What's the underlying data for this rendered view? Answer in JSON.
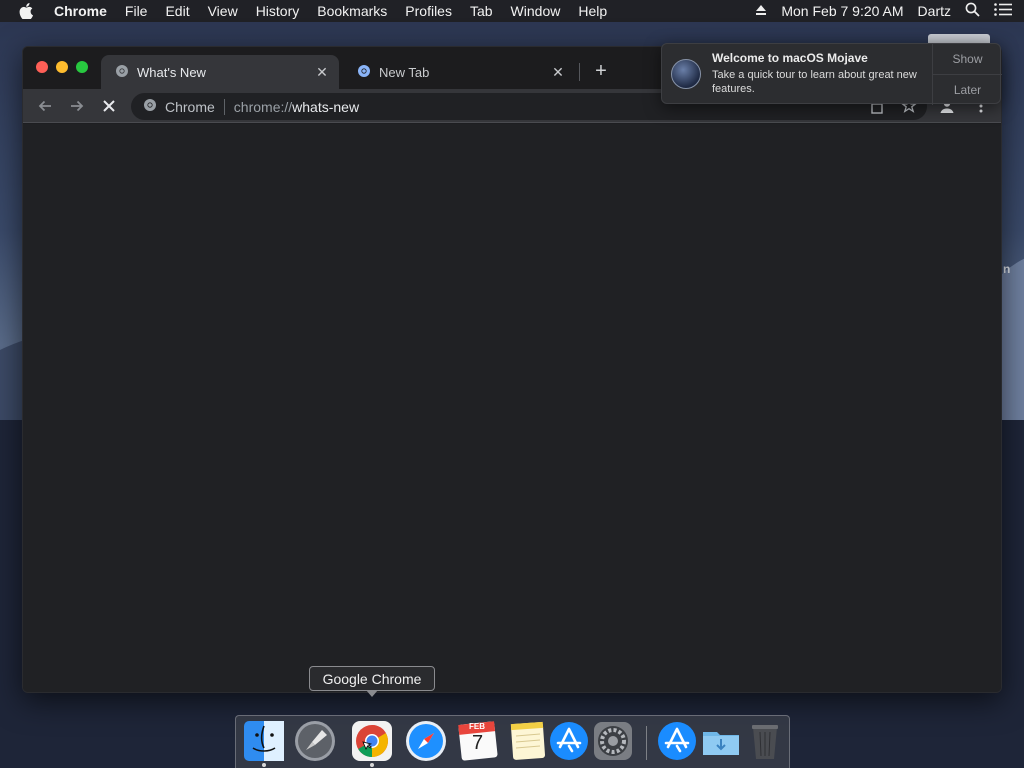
{
  "menubar": {
    "items": [
      "Chrome",
      "File",
      "Edit",
      "View",
      "History",
      "Bookmarks",
      "Profiles",
      "Tab",
      "Window",
      "Help"
    ],
    "clock": "Mon Feb 7  9:20 AM",
    "user": "Dartz"
  },
  "browser": {
    "tabs": [
      {
        "title": "What's New"
      },
      {
        "title": "New Tab"
      }
    ],
    "omnibox": {
      "chip": "Chrome",
      "url_scheme": "chrome://",
      "url_path": "whats-new"
    }
  },
  "notification": {
    "title": "Welcome to macOS Mojave",
    "body": "Take a quick tour to learn about great new features.",
    "show_label": "Show",
    "later_label": "Later"
  },
  "desktop": {
    "file_label_fragment": "n"
  },
  "dock": {
    "tooltip": "Google Chrome",
    "calendar": {
      "month": "FEB",
      "day": "7"
    }
  },
  "icons": {
    "apple": "apple-icon",
    "eject": "eject-icon",
    "search": "search-icon",
    "list": "notification-center-icon"
  }
}
